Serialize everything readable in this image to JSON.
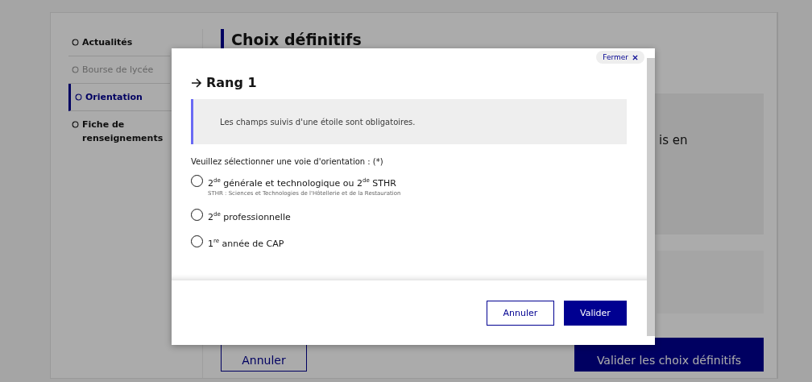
{
  "sidebar": {
    "items": [
      {
        "label": "Actualités",
        "selected": false,
        "disabled": false
      },
      {
        "label": "Bourse de lycée",
        "selected": false,
        "disabled": true
      },
      {
        "label": "Orientation",
        "selected": true,
        "disabled": false
      },
      {
        "label": "Fiche de renseignements",
        "selected": false,
        "disabled": false
      }
    ]
  },
  "page": {
    "title": "Choix définitifs",
    "panel_text": "is en",
    "cancel_button": "Annuler",
    "submit_button": "Valider les choix définitifs"
  },
  "modal": {
    "close_button": "Fermer",
    "title": "Rang 1",
    "notice": "Les champs suivis d'une étoile sont obligatoires.",
    "question": "Veuillez sélectionner une voie d'orientation : (*)",
    "options": [
      {
        "label": "2$^{de}$ générale et technologique ou 2$^{de}$ STHR",
        "hint": "STHR : Sciences et Technologies de l'Hôtellerie et de la Restauration",
        "selected": false
      },
      {
        "label": "2$^{de}$ professionnelle",
        "selected": false
      },
      {
        "label": "1$^{re}$ année de CAP",
        "selected": false
      }
    ],
    "cancel_button": "Annuler",
    "submit_button": "Valider"
  }
}
